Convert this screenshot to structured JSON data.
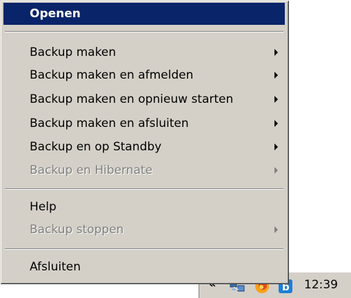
{
  "menu": {
    "default_item": "Openen",
    "backup_items": [
      {
        "label": "Backup maken",
        "disabled": false
      },
      {
        "label": "Backup maken en afmelden",
        "disabled": false
      },
      {
        "label": "Backup maken en opnieuw starten",
        "disabled": false
      },
      {
        "label": "Backup maken en afsluiten",
        "disabled": false
      },
      {
        "label": "Backup en op Standby",
        "disabled": false
      },
      {
        "label": "Backup en Hibernate",
        "disabled": true
      }
    ],
    "help": "Help",
    "stop_backup": "Backup stoppen",
    "exit": "Afsluiten"
  },
  "tray": {
    "chevron": "«",
    "icons": [
      "network-icon",
      "firefox-icon",
      "backup-app-icon"
    ],
    "clock": "12:39"
  },
  "colors": {
    "highlight": "#0a246a",
    "menu_bg": "#d4d0c8",
    "disabled_text": "#808080"
  }
}
